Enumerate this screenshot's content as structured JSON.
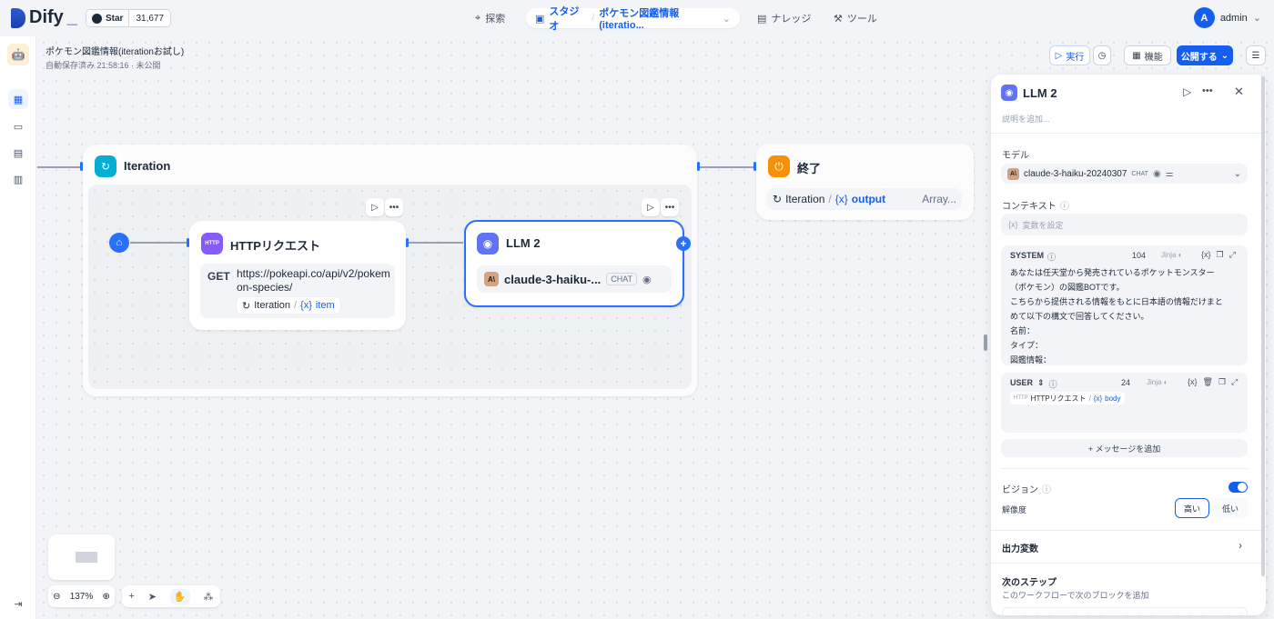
{
  "topbar": {
    "logo_text": "Dify",
    "github": {
      "star_label": "Star",
      "count": "31,677"
    },
    "nav": {
      "explore": "探索",
      "studio": "スタジオ",
      "app_crumb": "ポケモン図鑑情報(iteratio...",
      "knowledge": "ナレッジ",
      "tools": "ツール"
    },
    "user": {
      "initial": "A",
      "name": "admin"
    }
  },
  "app": {
    "title": "ポケモン図鑑情報(iterationお試し)",
    "status": "自動保存済み 21:58:16 · 未公開"
  },
  "toolbar": {
    "run": "実行",
    "features": "機能",
    "publish": "公開する"
  },
  "nodes": {
    "iteration": {
      "title": "Iteration"
    },
    "http": {
      "title": "HTTPリクエスト",
      "icon_text": "HTTP",
      "method": "GET",
      "url": "https://pokeapi.co/api/v2/pokemon-species/",
      "var_node": "Iteration",
      "var_name": "item"
    },
    "llm": {
      "title": "LLM 2",
      "model": "claude-3-haiku-...",
      "mode": "CHAT"
    },
    "end": {
      "title": "終了",
      "var_node": "Iteration",
      "var_name": "output",
      "var_type": "Array..."
    }
  },
  "zoom": {
    "level": "137%"
  },
  "panel": {
    "title": "LLM 2",
    "description_placeholder": "説明を追加...",
    "model_label": "モデル",
    "model_name": "claude-3-haiku-20240307",
    "model_mode": "CHAT",
    "context_label": "コンテキスト",
    "context_placeholder": "変数を設定",
    "system": {
      "label": "SYSTEM",
      "count": "104",
      "lines": [
        "あなたは任天堂から発売されているポケットモンスター",
        "（ポケモン）の図鑑BOTです。",
        "こちらから提供される情報をもとに日本語の情報だけまと",
        "めて以下の構文で回答してください。",
        "名前：",
        "タイプ：",
        "図鑑情報："
      ]
    },
    "user": {
      "label": "USER",
      "count": "24",
      "var_node": "HTTPリクエスト",
      "var_name": "body"
    },
    "add_message": "+ メッセージを追加",
    "vision_label": "ビジョン",
    "resolution_label": "解像度",
    "res_high": "高い",
    "res_low": "低い",
    "output_vars": "出力変数",
    "next_step": "次のステップ",
    "next_step_desc": "このワークフローで次のブロックを追加"
  },
  "colors": {
    "accent": "#155eef",
    "iteration_icon": "#06aed4",
    "http_icon": "#875bf7",
    "llm_icon": "#6172f3",
    "end_icon": "#f79009"
  }
}
